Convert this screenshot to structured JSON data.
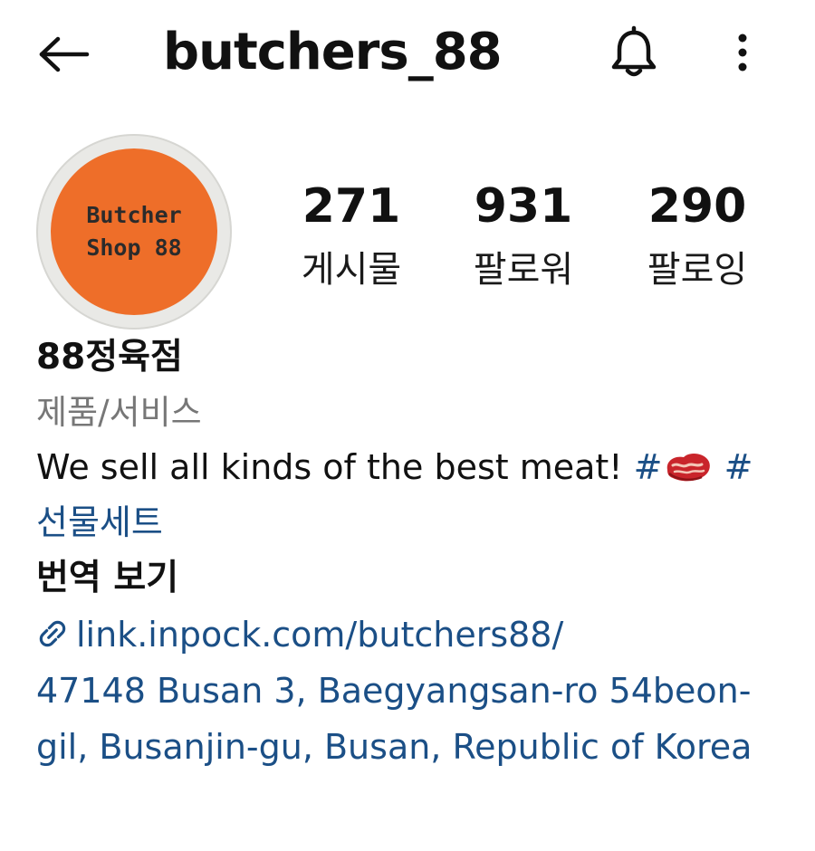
{
  "header": {
    "back_icon": "arrow-left-icon",
    "username": "butchers_88",
    "bell_icon": "bell-icon",
    "more_icon": "more-vertical-icon"
  },
  "avatar": {
    "line1": "Butcher",
    "line2": "Shop 88",
    "color": "#ee6e29"
  },
  "stats": {
    "posts": {
      "count": "271",
      "label": "게시물"
    },
    "followers": {
      "count": "931",
      "label": "팔로워"
    },
    "following": {
      "count": "290",
      "label": "팔로잉"
    }
  },
  "bio": {
    "display_name": "88정육점",
    "category": "제품/서비스",
    "description": "We sell all kinds of the best meat! ",
    "hashtag1_symbol": "#",
    "hashtag1_icon": "steak-emoji-icon",
    "hashtag2": "# 선물세트",
    "translate_label": "번역 보기",
    "link_icon": "link-icon",
    "link": "link.inpock.com/butchers88/",
    "address": "47148 Busan 3, Baegyangsan-ro 54beon-gil, Busanjin-gu, Busan, Republic of Korea"
  },
  "colors": {
    "link_blue": "#1b4f86",
    "category_gray": "#777777",
    "text": "#111111"
  }
}
